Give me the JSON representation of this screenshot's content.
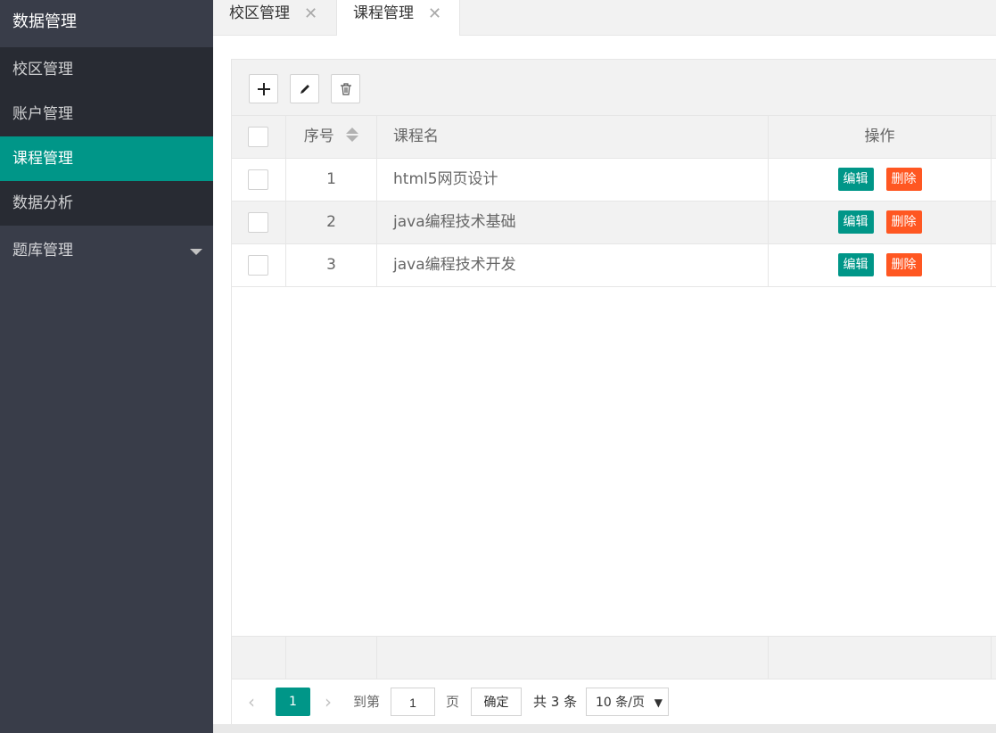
{
  "sidebar": {
    "title": "数据管理",
    "items": [
      {
        "label": "校区管理"
      },
      {
        "label": "账户管理"
      },
      {
        "label": "课程管理"
      },
      {
        "label": "数据分析"
      },
      {
        "label": "题库管理"
      }
    ]
  },
  "tabs": [
    {
      "label": "校区管理",
      "close": "✕"
    },
    {
      "label": "课程管理",
      "close": "✕"
    }
  ],
  "toolbar": {
    "add_icon": "plus-icon",
    "edit_icon": "pencil-icon",
    "delete_icon": "trash-icon"
  },
  "table": {
    "headers": {
      "num": "序号",
      "name": "课程名",
      "op": "操作"
    },
    "rows": [
      {
        "num": "1",
        "name": "html5网页设计",
        "edit": "编辑",
        "del": "删除"
      },
      {
        "num": "2",
        "name": "java编程技术基础",
        "edit": "编辑",
        "del": "删除"
      },
      {
        "num": "3",
        "name": "java编程技术开发",
        "edit": "编辑",
        "del": "删除"
      }
    ]
  },
  "pager": {
    "prev": "‹",
    "current": "1",
    "next": "›",
    "goto_label": "到第",
    "goto_value": "1",
    "page_unit": "页",
    "confirm": "确定",
    "total": "共 3 条",
    "page_size": "10 条/页"
  },
  "colors": {
    "accent": "#009688",
    "danger": "#ff5722",
    "sidebar": "#393d49"
  }
}
